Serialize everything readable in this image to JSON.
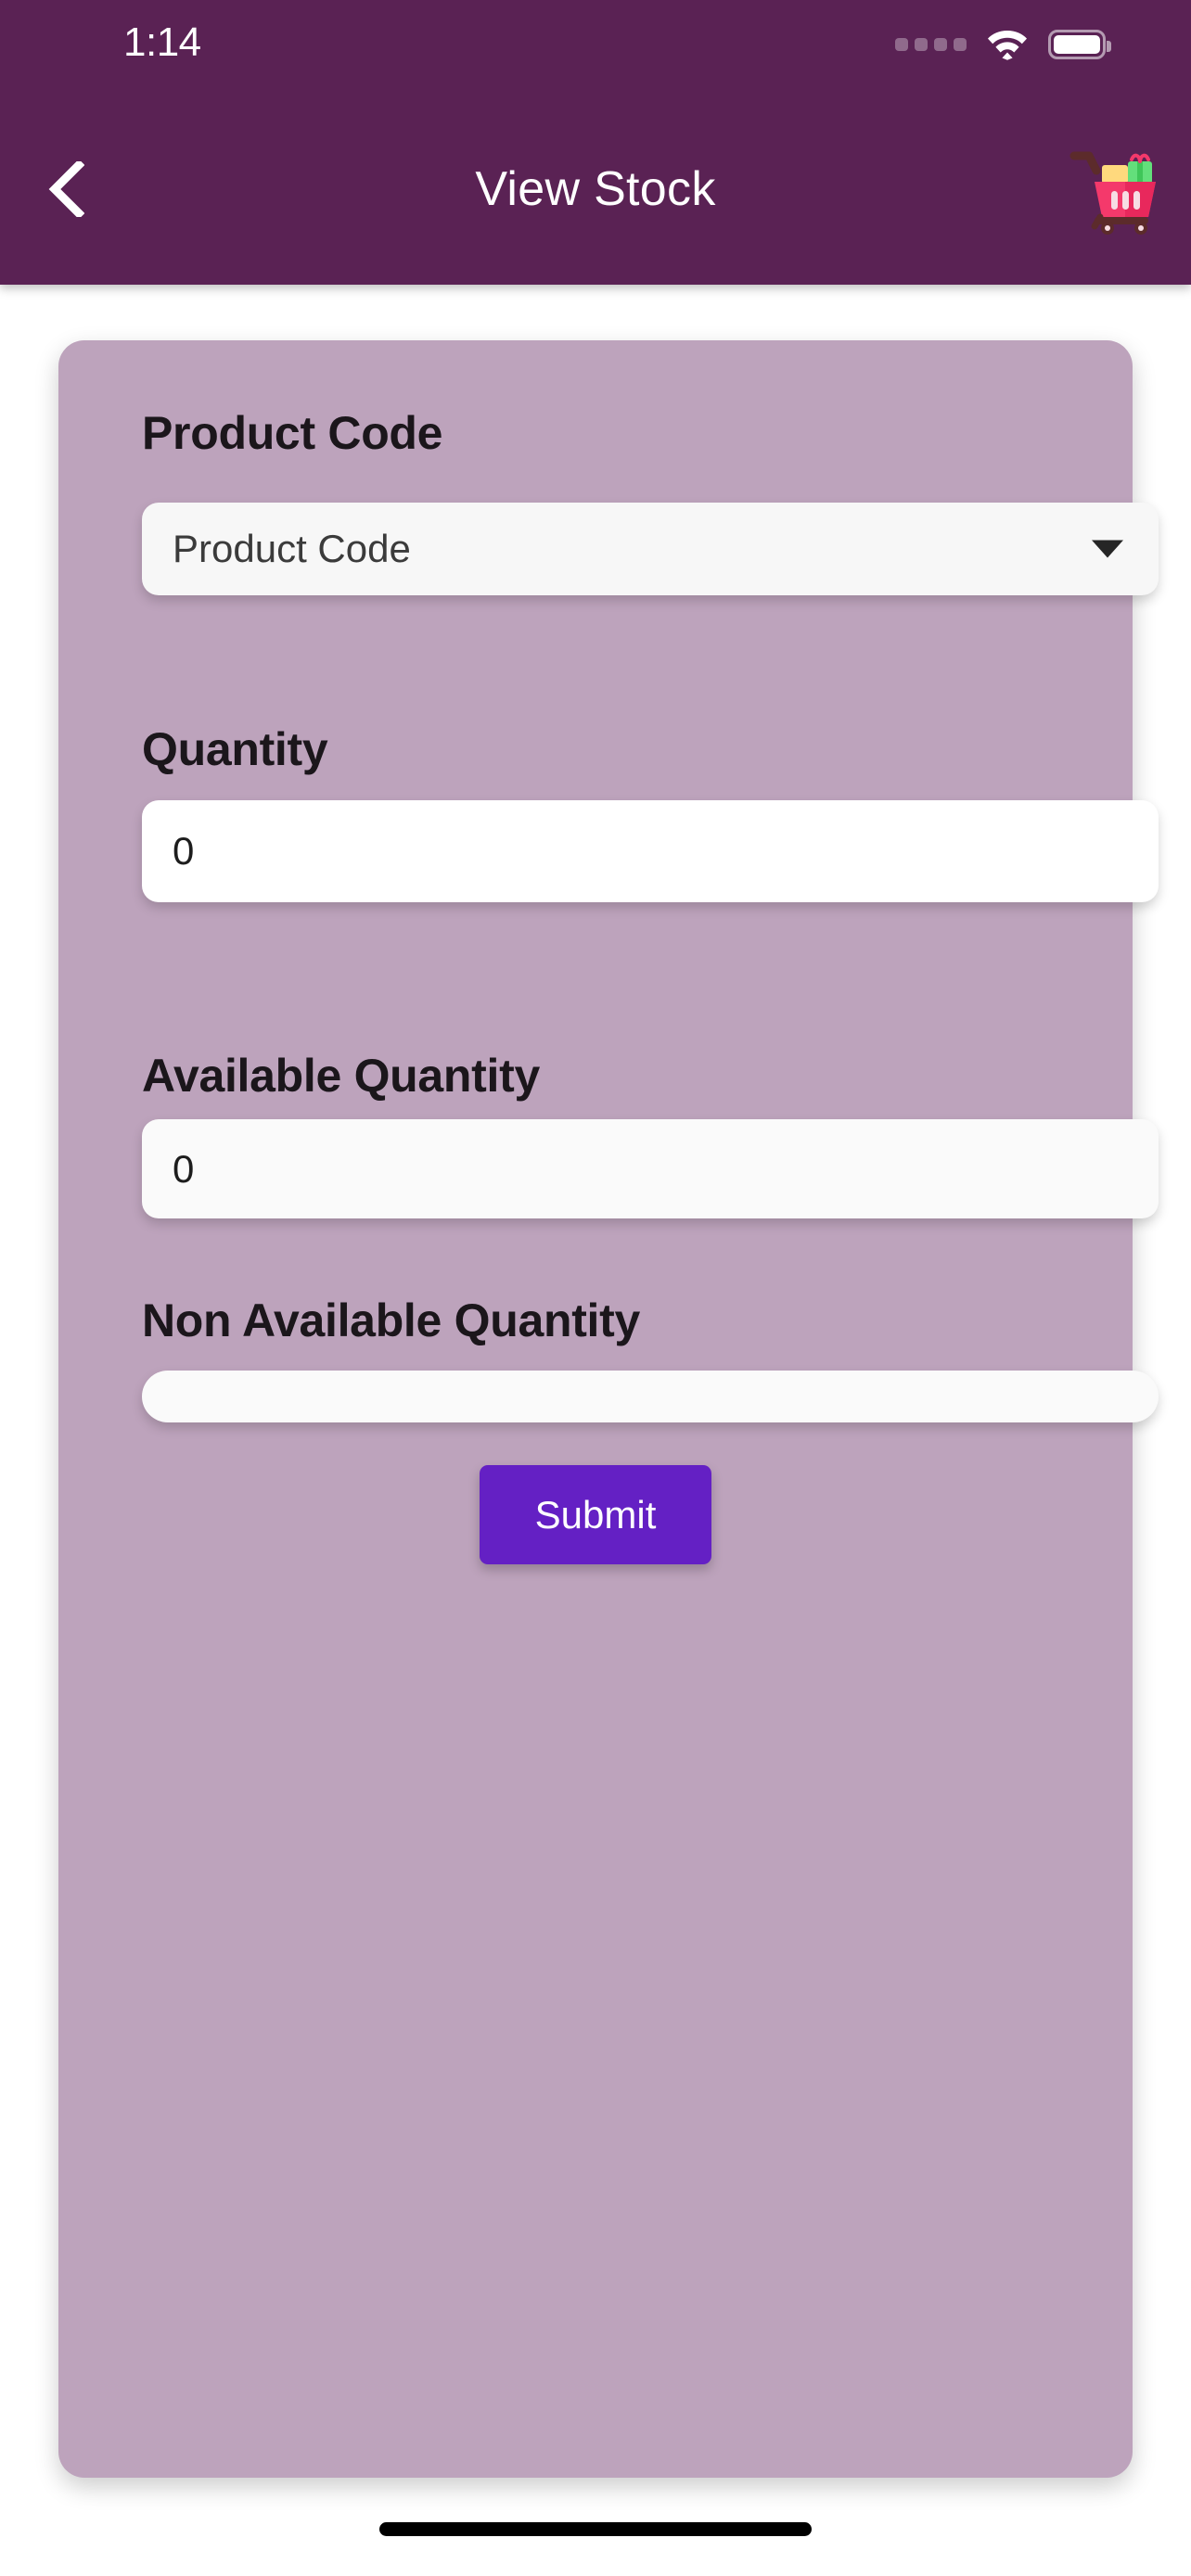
{
  "statusbar": {
    "time": "1:14",
    "signal_icon": "signal-dots-icon",
    "wifi_icon": "wifi-icon",
    "battery_icon": "battery-full-icon"
  },
  "navbar": {
    "back_icon": "chevron-left-icon",
    "title": "View Stock",
    "cart_icon": "shopping-cart-icon"
  },
  "form": {
    "product_code": {
      "label": "Product Code",
      "selected": "Product Code",
      "caret_icon": "chevron-down-icon"
    },
    "quantity": {
      "label": "Quantity",
      "value": "0"
    },
    "available_quantity": {
      "label": "Available Quantity",
      "value": "0"
    },
    "non_available_quantity": {
      "label": "Non Available Quantity",
      "value": ""
    },
    "submit_label": "Submit"
  },
  "colors": {
    "appbar": "#5a2254",
    "card": "#bda3bc",
    "submit": "#6420c4",
    "page": "#ffffff",
    "cart_basket": "#f4396b",
    "cart_gift": "#63df7b",
    "cart_box": "#ffd97d",
    "cart_frame": "#5c2b2b"
  }
}
